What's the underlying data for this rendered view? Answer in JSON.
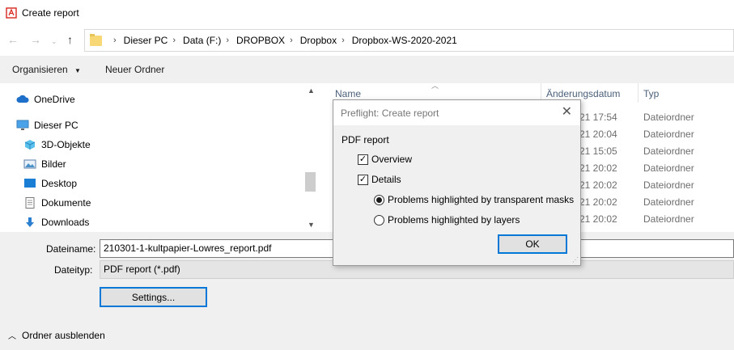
{
  "window": {
    "title": "Create report"
  },
  "address": {
    "breadcrumbs": [
      "Dieser PC",
      "Data (F:)",
      "DROPBOX",
      "Dropbox",
      "Dropbox-WS-2020-2021"
    ]
  },
  "toolbar": {
    "organize": "Organisieren",
    "new_folder": "Neuer Ordner"
  },
  "nav": {
    "items": [
      "OneDrive",
      "Dieser PC",
      "3D-Objekte",
      "Bilder",
      "Desktop",
      "Dokumente",
      "Downloads"
    ]
  },
  "files": {
    "columns": {
      "name": "Name",
      "date": "Änderungsdatum",
      "type": "Typ"
    },
    "rows": [
      {
        "date": "21 17:54",
        "type": "Dateiordner"
      },
      {
        "date": "21 20:04",
        "type": "Dateiordner"
      },
      {
        "date": "21 15:05",
        "type": "Dateiordner"
      },
      {
        "date": "21 20:02",
        "type": "Dateiordner"
      },
      {
        "date": "21 20:02",
        "type": "Dateiordner"
      },
      {
        "date": "21 20:02",
        "type": "Dateiordner"
      },
      {
        "date": "21 20:02",
        "type": "Dateiordner"
      }
    ]
  },
  "form": {
    "filename_label": "Dateiname:",
    "filename_value": "210301-1-kultpapier-Lowres_report.pdf",
    "filetype_label": "Dateityp:",
    "filetype_value": "PDF report (*.pdf)",
    "settings_button": "Settings...",
    "hide_folders": "Ordner ausblenden"
  },
  "dialog": {
    "title": "Preflight: Create report",
    "section": "PDF report",
    "overview": {
      "label": "Overview",
      "checked": true
    },
    "details": {
      "label": "Details",
      "checked": true
    },
    "radio_masks": {
      "label": "Problems highlighted by transparent masks",
      "selected": true
    },
    "radio_layers": {
      "label": "Problems highlighted by layers",
      "selected": false
    },
    "ok": "OK"
  },
  "colors": {
    "accent": "#0078d7",
    "pdf_icon": "#d9261c",
    "folder": "#f8d775"
  }
}
